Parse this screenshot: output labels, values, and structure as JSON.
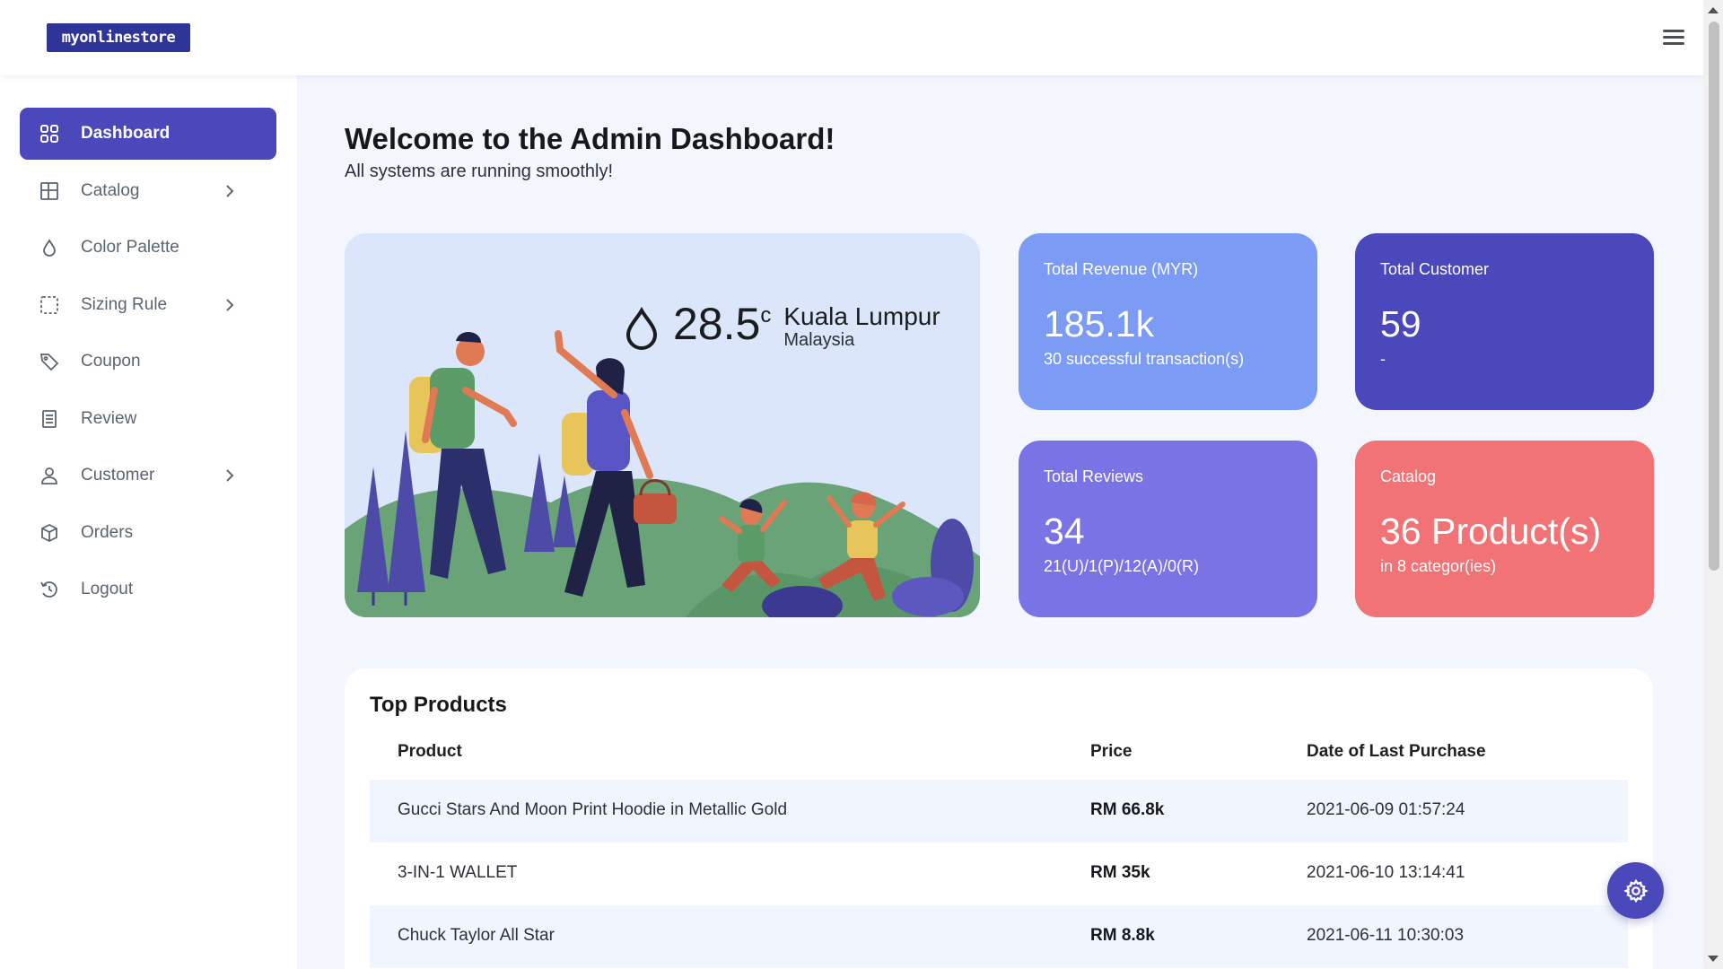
{
  "header": {
    "logo_text": "myonlinestore",
    "menu_icon": "hamburger-menu-icon"
  },
  "sidebar": {
    "items": [
      {
        "label": "Dashboard",
        "icon": "grid-icon",
        "active": true,
        "has_submenu": false
      },
      {
        "label": "Catalog",
        "icon": "table-icon",
        "active": false,
        "has_submenu": true
      },
      {
        "label": "Color Palette",
        "icon": "droplet-icon",
        "active": false,
        "has_submenu": false
      },
      {
        "label": "Sizing Rule",
        "icon": "dashed-square-icon",
        "active": false,
        "has_submenu": true
      },
      {
        "label": "Coupon",
        "icon": "tag-icon",
        "active": false,
        "has_submenu": false
      },
      {
        "label": "Review",
        "icon": "document-icon",
        "active": false,
        "has_submenu": false
      },
      {
        "label": "Customer",
        "icon": "user-icon",
        "active": false,
        "has_submenu": true
      },
      {
        "label": "Orders",
        "icon": "box-icon",
        "active": false,
        "has_submenu": false
      },
      {
        "label": "Logout",
        "icon": "logout-icon",
        "active": false,
        "has_submenu": false
      }
    ]
  },
  "main": {
    "title": "Welcome to the Admin Dashboard!",
    "subtitle": "All systems are running smoothly!"
  },
  "weather": {
    "temperature": "28.5",
    "unit": "c",
    "city": "Kuala Lumpur",
    "country": "Malaysia"
  },
  "stats": {
    "revenue": {
      "label": "Total Revenue (MYR)",
      "value": "185.1k",
      "sub": "30 successful transaction(s)",
      "color": "#7b9bf5"
    },
    "customers": {
      "label": "Total Customer",
      "value": "59",
      "sub": "-",
      "color": "#4a48ba"
    },
    "reviews": {
      "label": "Total Reviews",
      "value": "34",
      "sub": "21(U)/1(P)/12(A)/0(R)",
      "color": "#7a73e5"
    },
    "catalog": {
      "label": "Catalog",
      "value": "36 Product(s)",
      "sub": "in 8 categor(ies)",
      "color": "#f17375"
    }
  },
  "top_products": {
    "title": "Top Products",
    "columns": [
      "Product",
      "Price",
      "Date of Last Purchase"
    ],
    "rows": [
      {
        "product": "Gucci Stars And Moon Print Hoodie in Metallic Gold",
        "price": "RM 66.8k",
        "date": "2021-06-09 01:57:24"
      },
      {
        "product": "3-IN-1 WALLET",
        "price": "RM 35k",
        "date": "2021-06-10 13:14:41"
      },
      {
        "product": "Chuck Taylor All Star",
        "price": "RM 8.8k",
        "date": "2021-06-11 10:30:03"
      }
    ]
  },
  "colors": {
    "primary": "#4a48ba",
    "background": "#f3f6fd"
  }
}
